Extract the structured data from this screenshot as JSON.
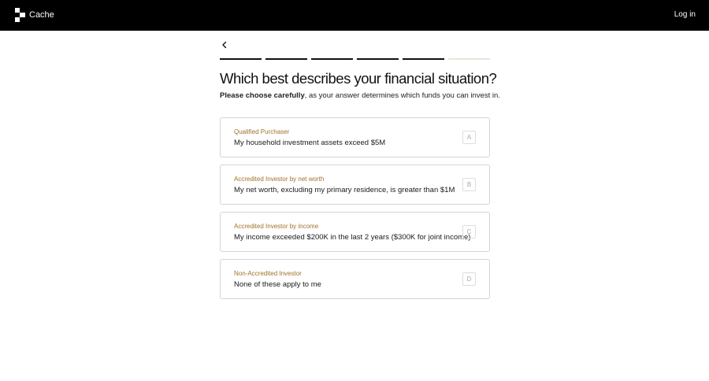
{
  "header": {
    "brand": "Cache",
    "login_label": "Log in"
  },
  "progress": {
    "total_steps": 6,
    "completed_steps": 5
  },
  "question": {
    "title": "Which best describes your financial situation?",
    "subtitle_bold": "Please choose carefully",
    "subtitle_rest": ", as your answer determines which funds you can invest in."
  },
  "options": [
    {
      "category": "Qualified Purchaser",
      "description": "My household investment assets exceed $5M",
      "key": "A"
    },
    {
      "category": "Accredited Investor by net worth",
      "description": "My net worth, excluding my primary residence, is greater than $1M",
      "key": "B"
    },
    {
      "category": "Accredited Investor by income",
      "description": "My income exceeded $200K in the last 2 years ($300K for joint income)",
      "key": "C"
    },
    {
      "category": "Non-Accredited Investor",
      "description": "None of these apply to me",
      "key": "D"
    }
  ],
  "colors": {
    "header_bg": "#000000",
    "accent": "#a07228",
    "progress_done": "#111111",
    "progress_todo": "#ebe6da"
  },
  "icons": {
    "logo": "cache-logo-icon",
    "back": "chevron-left-icon"
  }
}
